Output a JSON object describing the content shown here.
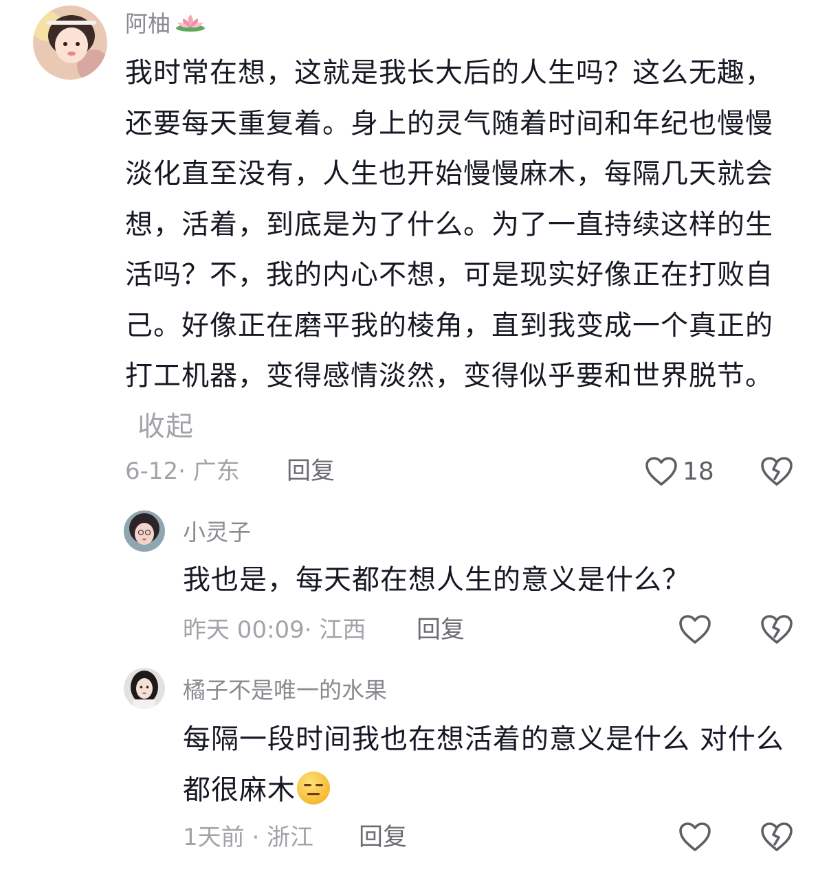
{
  "comments": [
    {
      "username": "阿柚",
      "username_badge_icon": "lotus-icon",
      "text": "我时常在想，这就是我长大后的人生吗？这么无趣，还要每天重复着。身上的灵气随着时间和年纪也慢慢淡化直至没有，人生也开始慢慢麻木，每隔几天就会想，活着，到底是为了什么。为了一直持续这样的生活吗？不，我的内心不想，可是现实好像正在打败自己。好像正在磨平我的棱角，直到我变成一个真正的打工机器，变得感情淡然，变得似乎要和世界脱节。",
      "collapse_label": "收起",
      "meta": "6-12· 广东",
      "reply_label": "回复",
      "like_count": "18"
    },
    {
      "username": "小灵子",
      "text": "我也是，每天都在想人生的意义是什么？",
      "meta": "昨天 00:09· 江西",
      "reply_label": "回复",
      "like_count": ""
    },
    {
      "username": "橘子不是唯一的水果",
      "text": "每隔一段时间我也在想活着的意义是什么 对什么都很麻木",
      "text_emoji": "expressionless-face-emoji",
      "meta": "1天前 · 浙江",
      "reply_label": "回复",
      "like_count": ""
    }
  ],
  "colors": {
    "text_primary": "#161823",
    "text_secondary": "#8a8b91",
    "meta": "#a2a3a8",
    "icon": "#5e5f64"
  }
}
